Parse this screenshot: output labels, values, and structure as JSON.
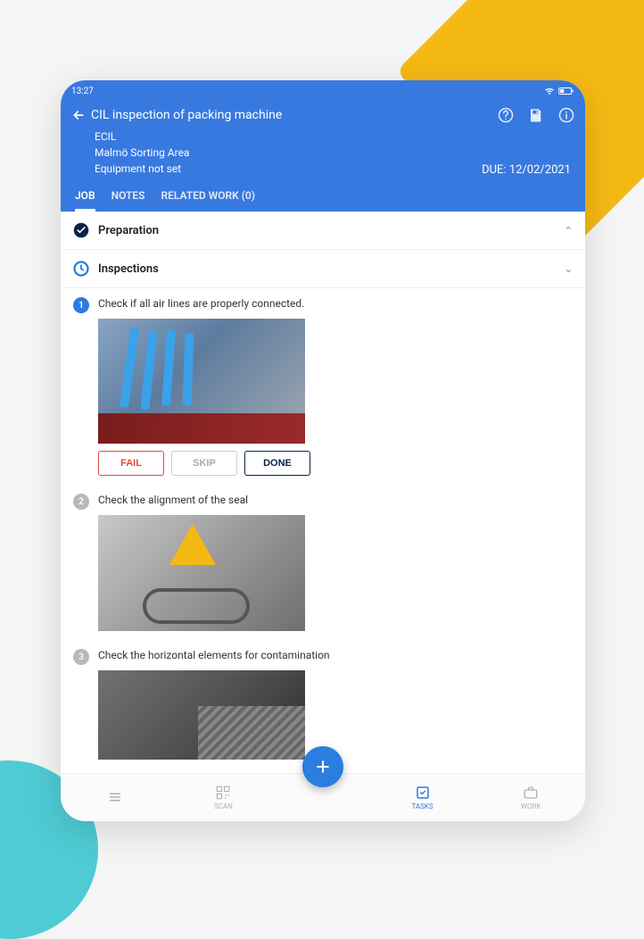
{
  "status_bar": {
    "time": "13:27"
  },
  "header": {
    "title": "CIL inspection of packing machine",
    "line1": "ECIL",
    "line2": "Malmö Sorting Area",
    "line3": "Equipment not set",
    "due_label": "DUE: 12/02/2021"
  },
  "tabs": {
    "job": "JOB",
    "notes": "NOTES",
    "related": "RELATED WORK (0)"
  },
  "sections": {
    "preparation": "Preparation",
    "inspections": "Inspections"
  },
  "steps": [
    {
      "num": "1",
      "text": "Check if all air lines are properly connected."
    },
    {
      "num": "2",
      "text": "Check the alignment of the seal"
    },
    {
      "num": "3",
      "text": "Check the horizontal elements for contamination"
    }
  ],
  "actions": {
    "fail": "FAIL",
    "skip": "SKIP",
    "done": "DONE"
  },
  "bottom_nav": {
    "scan": "SCAN",
    "tasks": "TASKS",
    "work": "WORK"
  }
}
